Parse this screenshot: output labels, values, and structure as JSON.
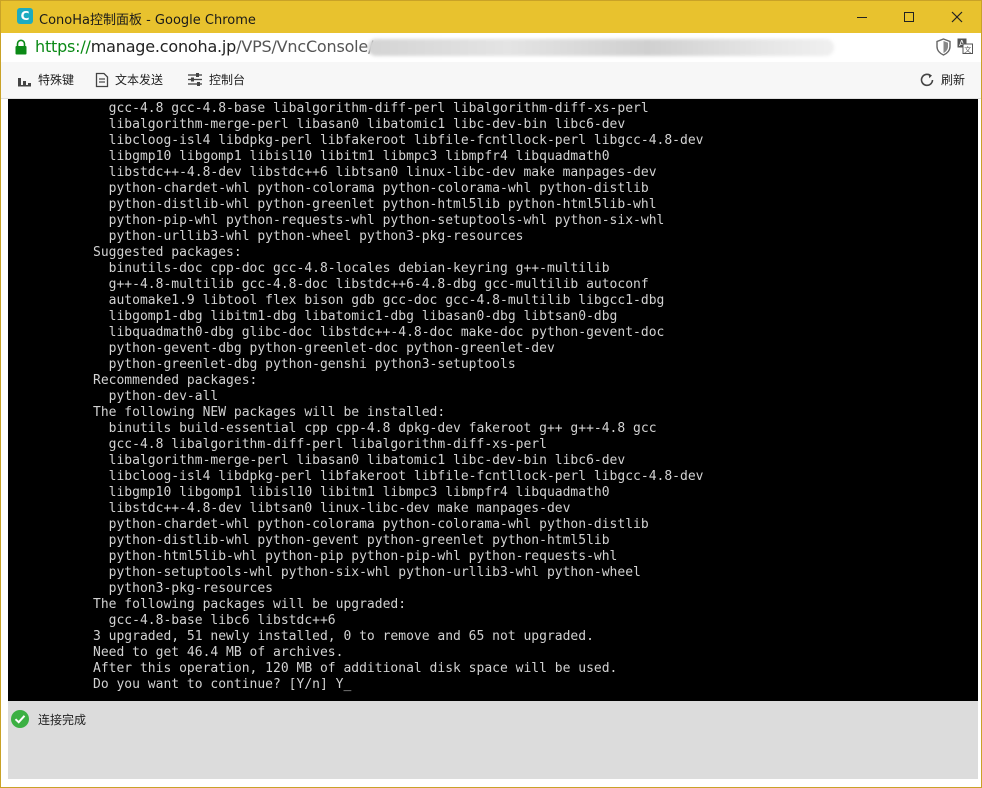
{
  "window": {
    "title": "ConoHa控制面板 - Google Chrome",
    "app_icon_letter": "C",
    "accent": "#e8c22e"
  },
  "address_bar": {
    "url_scheme": "https://",
    "url_host": "manage.conoha.jp",
    "url_path": "/VPS/VncConsole/"
  },
  "toolbar": {
    "special_keys_label": "特殊键",
    "send_text_label": "文本发送",
    "console_label": "控制台",
    "refresh_label": "刷新"
  },
  "terminal": {
    "lines": [
      "  gcc-4.8 gcc-4.8-base libalgorithm-diff-perl libalgorithm-diff-xs-perl",
      "  libalgorithm-merge-perl libasan0 libatomic1 libc-dev-bin libc6-dev",
      "  libcloog-isl4 libdpkg-perl libfakeroot libfile-fcntllock-perl libgcc-4.8-dev",
      "  libgmp10 libgomp1 libisl10 libitm1 libmpc3 libmpfr4 libquadmath0",
      "  libstdc++-4.8-dev libstdc++6 libtsan0 linux-libc-dev make manpages-dev",
      "  python-chardet-whl python-colorama python-colorama-whl python-distlib",
      "  python-distlib-whl python-greenlet python-html5lib python-html5lib-whl",
      "  python-pip-whl python-requests-whl python-setuptools-whl python-six-whl",
      "  python-urllib3-whl python-wheel python3-pkg-resources",
      "Suggested packages:",
      "  binutils-doc cpp-doc gcc-4.8-locales debian-keyring g++-multilib",
      "  g++-4.8-multilib gcc-4.8-doc libstdc++6-4.8-dbg gcc-multilib autoconf",
      "  automake1.9 libtool flex bison gdb gcc-doc gcc-4.8-multilib libgcc1-dbg",
      "  libgomp1-dbg libitm1-dbg libatomic1-dbg libasan0-dbg libtsan0-dbg",
      "  libquadmath0-dbg glibc-doc libstdc++-4.8-doc make-doc python-gevent-doc",
      "  python-gevent-dbg python-greenlet-doc python-greenlet-dev",
      "  python-greenlet-dbg python-genshi python3-setuptools",
      "Recommended packages:",
      "  python-dev-all",
      "The following NEW packages will be installed:",
      "  binutils build-essential cpp cpp-4.8 dpkg-dev fakeroot g++ g++-4.8 gcc",
      "  gcc-4.8 libalgorithm-diff-perl libalgorithm-diff-xs-perl",
      "  libalgorithm-merge-perl libasan0 libatomic1 libc-dev-bin libc6-dev",
      "  libcloog-isl4 libdpkg-perl libfakeroot libfile-fcntllock-perl libgcc-4.8-dev",
      "  libgmp10 libgomp1 libisl10 libitm1 libmpc3 libmpfr4 libquadmath0",
      "  libstdc++-4.8-dev libtsan0 linux-libc-dev make manpages-dev",
      "  python-chardet-whl python-colorama python-colorama-whl python-distlib",
      "  python-distlib-whl python-gevent python-greenlet python-html5lib",
      "  python-html5lib-whl python-pip python-pip-whl python-requests-whl",
      "  python-setuptools-whl python-six-whl python-urllib3-whl python-wheel",
      "  python3-pkg-resources",
      "The following packages will be upgraded:",
      "  gcc-4.8-base libc6 libstdc++6",
      "3 upgraded, 51 newly installed, 0 to remove and 65 not upgraded.",
      "Need to get 46.4 MB of archives.",
      "After this operation, 120 MB of additional disk space will be used.",
      "Do you want to continue? [Y/n] Y"
    ],
    "cursor": "_"
  },
  "status": {
    "text": "连接完成",
    "color": "#3cb043"
  }
}
